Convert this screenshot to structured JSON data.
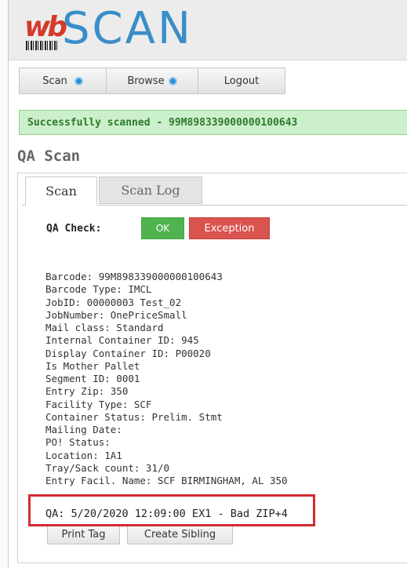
{
  "logo": {
    "wb": "wb",
    "scan": "SCAN"
  },
  "nav": {
    "scan": "Scan",
    "browse": "Browse",
    "logout": "Logout"
  },
  "alert": {
    "message": "Successfully scanned - 99M898339000000100643"
  },
  "page": {
    "title": "QA Scan"
  },
  "tabs": {
    "scan": "Scan",
    "scan_log": "Scan Log"
  },
  "qa_check": {
    "label": "QA Check:",
    "ok": "OK",
    "exception": "Exception"
  },
  "details": [
    "Barcode: 99M898339000000100643",
    "Barcode Type: IMCL",
    "JobID: 00000003 Test_02",
    "JobNumber: OnePriceSmall",
    "Mail class: Standard",
    "Internal Container ID: 945",
    "Display Container ID: P00020",
    "Is Mother Pallet",
    "Segment ID: 0001",
    "Entry Zip: 350",
    "Facility Type: SCF",
    "Container Status: Prelim. Stmt",
    "Mailing Date:",
    "PO! Status:",
    "Location: 1A1",
    "Tray/Sack count: 31/0",
    "Entry Facil. Name: SCF BIRMINGHAM, AL 350"
  ],
  "qa_line": "QA: 5/20/2020 12:09:00 EX1 - Bad ZIP+4",
  "actions": {
    "print_tag": "Print Tag",
    "create_sibling": "Create Sibling"
  },
  "colors": {
    "ok": "#4fb450",
    "exception": "#d9534f",
    "success_bg": "#ccf0cb",
    "logo_blue": "#3a8ec8",
    "logo_red": "#d33a2c",
    "highlight": "#d42a35"
  }
}
